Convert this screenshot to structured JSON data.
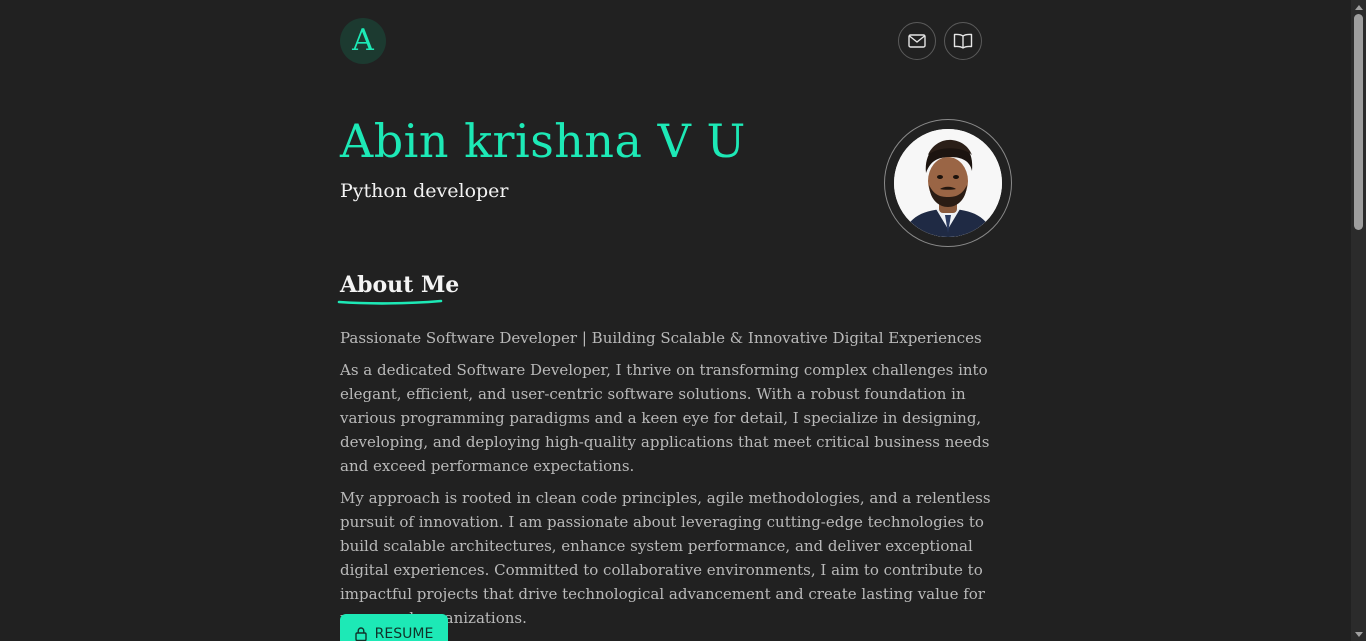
{
  "header": {
    "logo_letter": "A",
    "mail_icon": "mail-icon",
    "book_icon": "book-open-icon"
  },
  "hero": {
    "name": "Abin krishna V U",
    "role": "Python developer",
    "avatar_icon": "profile-photo"
  },
  "about": {
    "title": "About Me",
    "tagline": "Passionate Software Developer | Building Scalable & Innovative Digital Experiences",
    "paragraph_1": "As a dedicated Software Developer, I thrive on transforming complex challenges into elegant, efficient, and user-centric software solutions. With a robust foundation in various programming paradigms and a keen eye for detail, I specialize in designing, developing, and deploying high-quality applications that meet critical business needs and exceed performance expectations.",
    "paragraph_2": "My approach is rooted in clean code principles, agile methodologies, and a relentless pursuit of innovation. I am passionate about leveraging cutting-edge technologies to build scalable architectures, enhance system performance, and deliver exceptional digital experiences. Committed to collaborative environments, I aim to contribute to impactful projects that drive technological advancement and create lasting value for users and organizations."
  },
  "actions": {
    "resume_label": "RESUME",
    "resume_icon": "lock-icon"
  },
  "colors": {
    "background": "#212121",
    "accent": "#1de9b6",
    "text_muted": "#b9b9b9"
  }
}
